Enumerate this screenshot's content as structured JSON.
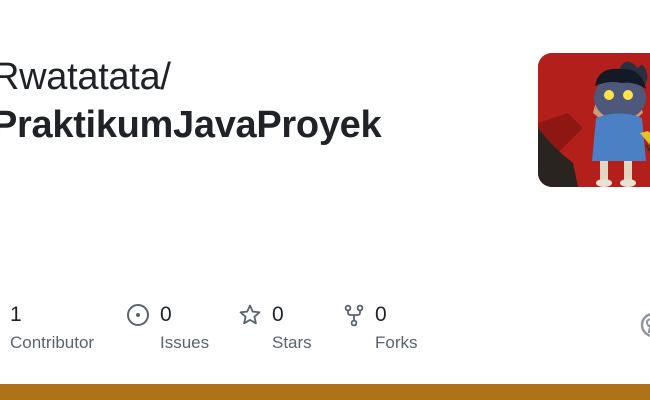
{
  "repo": {
    "owner": "Rwatatata/",
    "name": "PraktikumJavaProyek"
  },
  "stats": [
    {
      "value": "1",
      "label": "Contributor",
      "icon": "people-icon"
    },
    {
      "value": "0",
      "label": "Issues",
      "icon": "issue-opened-icon"
    },
    {
      "value": "0",
      "label": "Stars",
      "icon": "star-icon"
    },
    {
      "value": "0",
      "label": "Forks",
      "icon": "repo-forked-icon"
    }
  ],
  "language_color": "#b07219",
  "avatar": {
    "icon": "cartoon-character-avatar"
  }
}
